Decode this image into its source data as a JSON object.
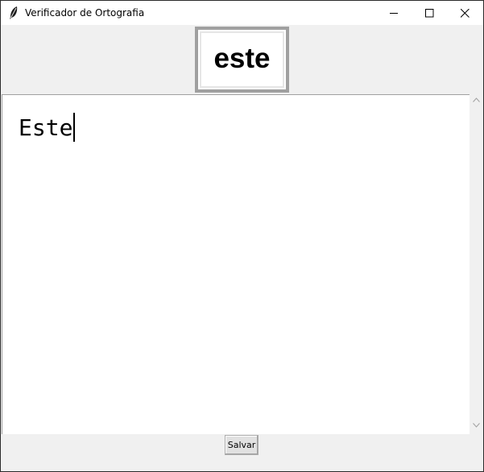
{
  "window": {
    "title": "Verificador de Ortografia",
    "icon": "feather-icon",
    "controls": [
      "minimize-icon",
      "maximize-icon",
      "close-icon"
    ]
  },
  "current_word": {
    "text": "este"
  },
  "editor": {
    "content": "Este"
  },
  "actions": {
    "save_label": "Salvar"
  },
  "colors": {
    "window_bg": "#f0f0f0",
    "editor_bg": "#ffffff",
    "word_box_border": "#a0a0a0",
    "button_bg": "#e1e1e1"
  }
}
